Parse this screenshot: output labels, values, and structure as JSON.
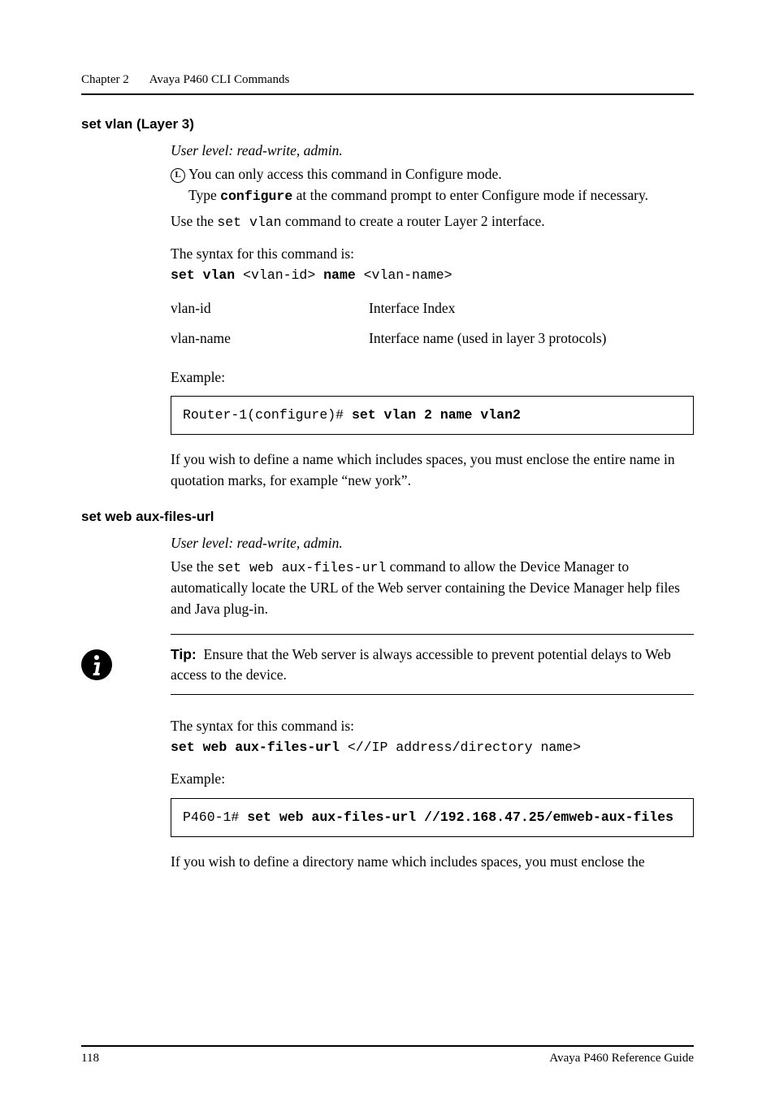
{
  "running_head": {
    "chapter": "Chapter 2",
    "title": "Avaya P460 CLI Commands"
  },
  "sec1": {
    "heading": "set vlan (Layer 3)",
    "userlevel": "User level: read-write, admin.",
    "note1a": "You can only access this command in Configure mode.",
    "note1b_pre": "Type ",
    "note1b_cmd": "configure",
    "note1b_post": " at the command prompt to enter Configure mode if necessary.",
    "use_pre": "Use the ",
    "use_cmd": "set vlan",
    "use_post": " command to create a router Layer 2 interface.",
    "syntax_label": "The syntax for this command is:",
    "syntax_b1": "set vlan",
    "syntax_a1": " <vlan-id> ",
    "syntax_b2": "name",
    "syntax_a2": " <vlan-name>",
    "params": [
      {
        "name": "vlan-id",
        "desc": "Interface Index"
      },
      {
        "name": "vlan-name",
        "desc": "Interface name (used in layer 3 protocols)"
      }
    ],
    "example_label": "Example:",
    "example_prompt": "Router-1(configure)# ",
    "example_cmd": "set vlan 2 name vlan2",
    "trailer": "If you wish to define a name which includes spaces, you must enclose the entire name in quotation marks, for example “new york”."
  },
  "sec2": {
    "heading": "set web aux-files-url",
    "userlevel": "User level: read-write, admin.",
    "use_pre": "Use the ",
    "use_cmd": "set web aux-files-url",
    "use_post": " command to allow the Device Manager to automatically locate the URL of the Web server containing the Device Manager help files and Java plug-in.",
    "tip_label": "Tip:",
    "tip_text": "Ensure that the Web server is always accessible to prevent potential delays to Web access to the device.",
    "syntax_label": "The syntax for this command is:",
    "syntax_b": "set web aux-files-url",
    "syntax_a": " <//IP address/directory name>",
    "example_label": "Example:",
    "example_prompt": "P460-1# ",
    "example_cmd": "set web aux-files-url //192.168.47.25/emweb-aux-files",
    "trailer": "If you wish to define a directory name which includes spaces, you must enclose the"
  },
  "footer": {
    "page": "118",
    "book": "Avaya P460 Reference Guide"
  }
}
